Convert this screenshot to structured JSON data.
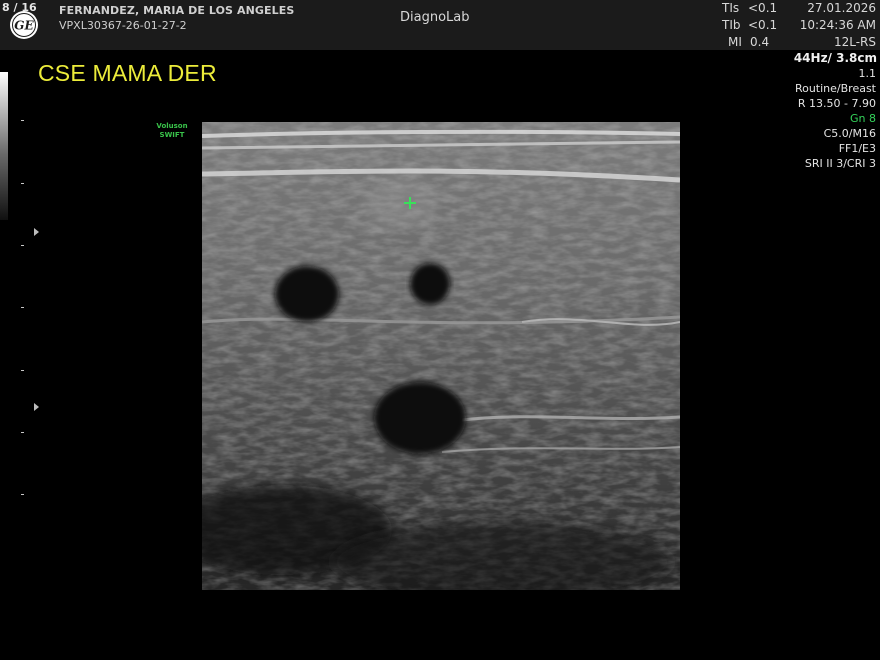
{
  "image_counter": "8 / 16",
  "header": {
    "logo_text": "GE",
    "patient_name": "FERNANDEZ, MARIA DE LOS ANGELES",
    "patient_id": "VPXL30367-26-01-27-2",
    "site": "DiagnoLab",
    "indices": [
      {
        "label": "TIs",
        "value": "<0.1"
      },
      {
        "label": "TIb",
        "value": "<0.1"
      },
      {
        "label": "MI",
        "value": "0.4"
      }
    ],
    "date": "27.01.2026",
    "time": "10:24:36 AM",
    "probe": "12L-RS"
  },
  "annotation_title": "CSE MAMA DER",
  "scan_params": {
    "freq_depth": "44Hz/ 3.8cm",
    "zoom": "1.1",
    "preset": "Routine/Breast",
    "range": "R 13.50 - 7.90",
    "gain": "Gn  8",
    "c_value": "C5.0/M16",
    "ff": "FF1/E3",
    "sri": "SRI II 3/CRI 3"
  },
  "brand": {
    "line1": "Voluson",
    "line2": "SWIFT"
  },
  "colors": {
    "annotation": "#ecec3a",
    "gain": "#34d25a",
    "marker": "#39e05a",
    "brand": "#39c24a"
  },
  "icons": {
    "logo": "ge-logo-icon",
    "cursor": "plus-cursor-icon",
    "depth_marker": "triangle-marker-icon"
  }
}
